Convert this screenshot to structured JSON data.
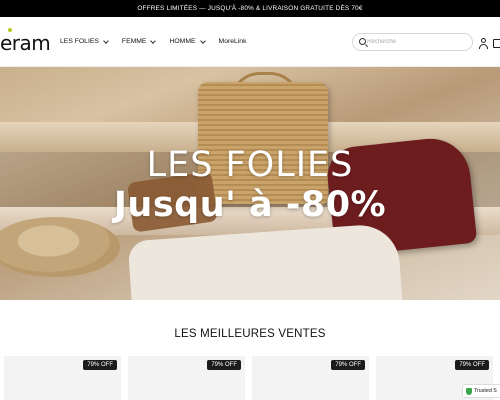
{
  "promo_bar": {
    "text": "OFFRES LIMITÉES — JUSQU'À -80% & LIVRAISON GRATUITE DÈS 70€"
  },
  "header": {
    "logo": "eram",
    "nav": [
      {
        "label": "LES FOLIES",
        "has_dropdown": true
      },
      {
        "label": "FEMME",
        "has_dropdown": true
      },
      {
        "label": "HOMME",
        "has_dropdown": true
      },
      {
        "label": "MoreLink",
        "has_dropdown": false
      }
    ],
    "search": {
      "placeholder": "Recherche"
    },
    "icons": [
      "search-icon",
      "user-icon",
      "bag-icon"
    ]
  },
  "hero": {
    "title": "LES FOLIES",
    "subtitle": "Jusqu' à  -80%"
  },
  "best_sellers": {
    "title": "LES MEILLEURES VENTES",
    "products": [
      {
        "badge": "79% OFF"
      },
      {
        "badge": "79% OFF"
      },
      {
        "badge": "79% OFF"
      },
      {
        "badge": "79% OFF"
      }
    ]
  },
  "trust_badge": {
    "text": "Trusted S"
  },
  "colors": {
    "promo_bg": "#000000",
    "badge_bg": "#1b1b1b",
    "logo_accent": "#b5c81e",
    "trust_green": "#3aa64b"
  }
}
